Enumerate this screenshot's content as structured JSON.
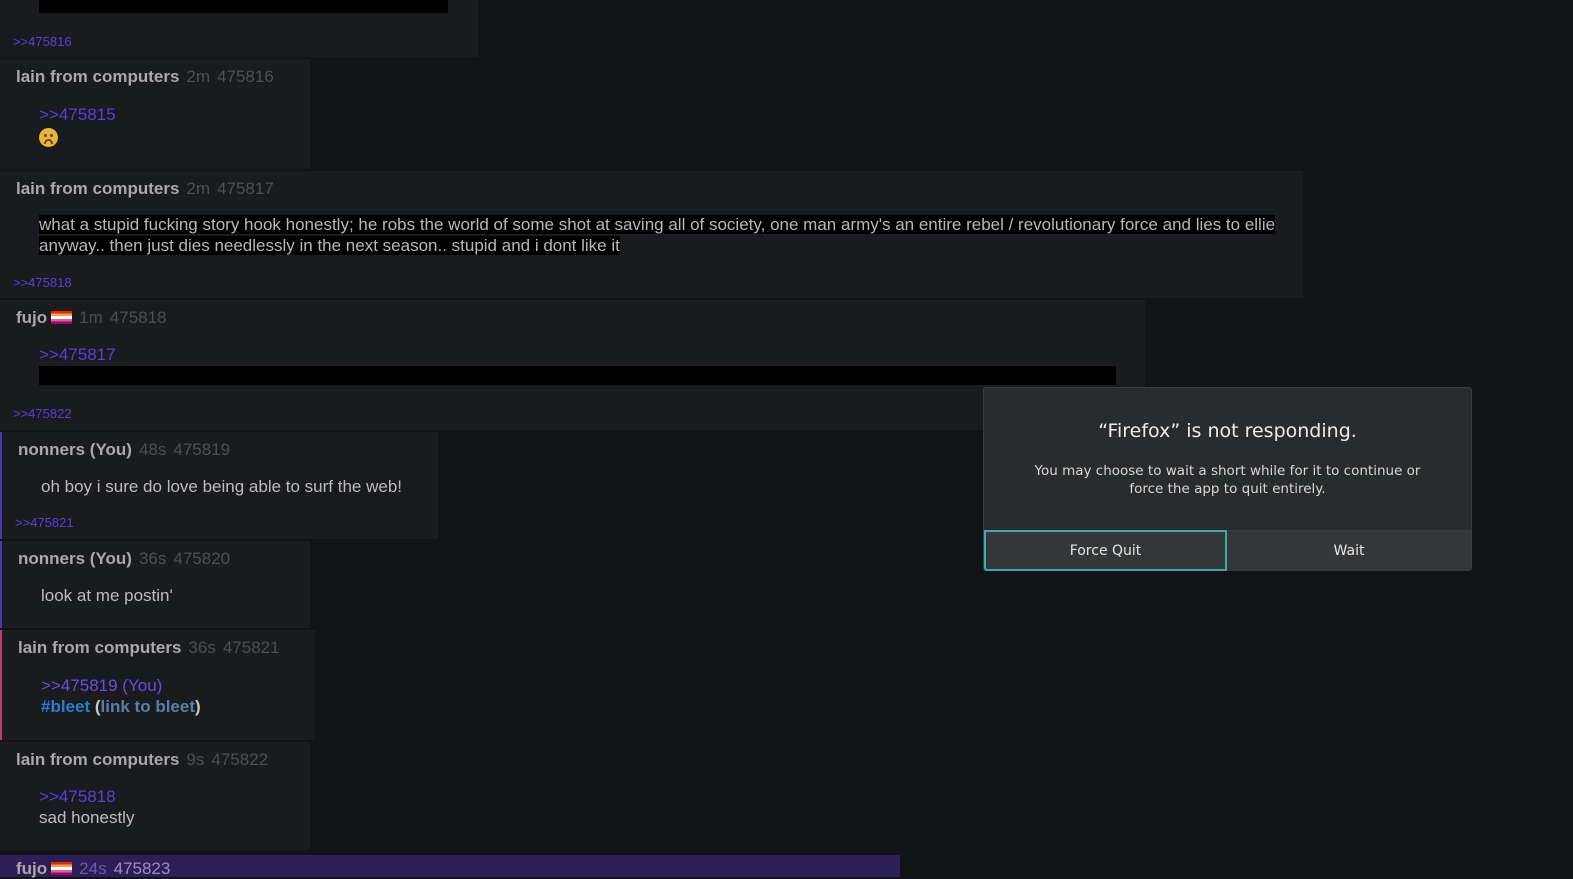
{
  "posts": [
    {
      "backlink": ">>475816"
    },
    {
      "name": "lain from computers",
      "age": "2m",
      "id": "475816",
      "quote": ">>475815",
      "emoji": "sad-face"
    },
    {
      "name": "lain from computers",
      "age": "2m",
      "id": "475817",
      "text": "what a stupid fucking story hook honestly;  he robs the world of some shot at saving all of society, one man army's an entire rebel / revolutionary force and lies to ellie anyway..  then just dies needlessly in the next season..  stupid and i dont like it",
      "backlink": ">>475818"
    },
    {
      "name": "fujo",
      "age": "1m",
      "id": "475818",
      "quote": ">>475817",
      "backlink": ">>475822"
    },
    {
      "name": "nonners (You)",
      "age": "48s",
      "id": "475819",
      "text": "oh boy i sure do love being able to surf the web!",
      "backlink": ">>475821"
    },
    {
      "name": "nonners (You)",
      "age": "36s",
      "id": "475820",
      "text": "look at me postin'"
    },
    {
      "name": "lain from computers",
      "age": "36s",
      "id": "475821",
      "quote": ">>475819 (You)",
      "hashtag": "#bleet",
      "link_open": "(",
      "link_text": "link to bleet",
      "link_close": ")"
    },
    {
      "name": "lain from computers",
      "age": "9s",
      "id": "475822",
      "quote": ">>475818",
      "text": "sad honestly"
    },
    {
      "name": "fujo",
      "age": "24s",
      "id": "475823"
    }
  ],
  "dialog": {
    "title": "“Firefox” is not responding.",
    "message": "You may choose to wait a short while for it to continue or force the app to quit entirely.",
    "force_quit": "Force Quit",
    "wait": "Wait"
  },
  "colors": {
    "accent": "#5b3ed6",
    "focus": "#3aa8b8",
    "dialog_bg": "#2a2b2d"
  }
}
